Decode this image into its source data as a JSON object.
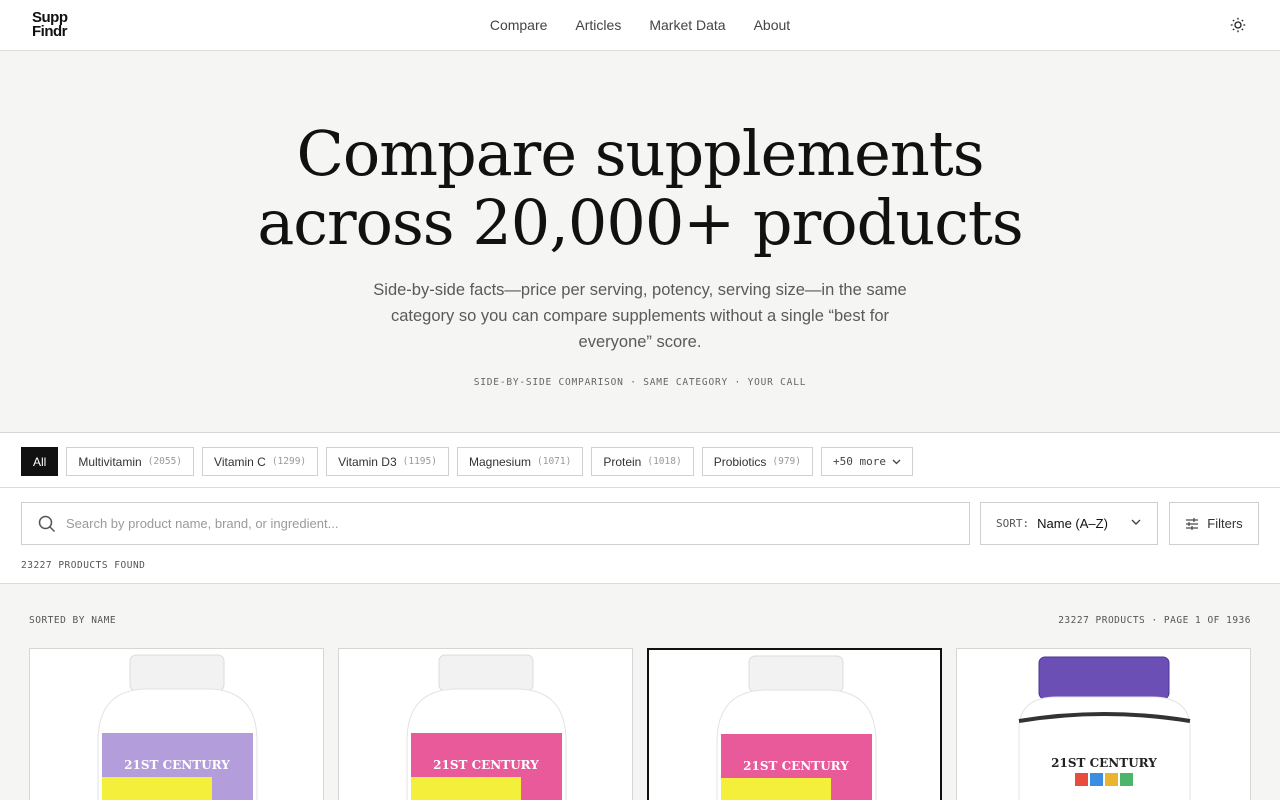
{
  "header": {
    "logo_line1": "Supp",
    "logo_line2": "Findr",
    "nav": [
      "Compare",
      "Articles",
      "Market Data",
      "About"
    ]
  },
  "hero": {
    "title_line1": "Compare supplements",
    "title_line2": "across 20,000+ products",
    "subtitle": "Side-by-side facts—price per serving, potency, serving size—in the same category so you can compare supplements without a single “best for everyone” score.",
    "tagline": "SIDE-BY-SIDE COMPARISON · SAME CATEGORY · YOUR CALL"
  },
  "categories": [
    {
      "label": "All",
      "count": ""
    },
    {
      "label": "Multivitamin",
      "count": "(2055)"
    },
    {
      "label": "Vitamin C",
      "count": "(1299)"
    },
    {
      "label": "Vitamin D3",
      "count": "(1195)"
    },
    {
      "label": "Magnesium",
      "count": "(1071)"
    },
    {
      "label": "Protein",
      "count": "(1018)"
    },
    {
      "label": "Probiotics",
      "count": "(979)"
    }
  ],
  "more_categories": "+50 more",
  "search": {
    "placeholder": "Search by product name, brand, or ingredient...",
    "value": ""
  },
  "sort": {
    "label": "SORT:",
    "value": "Name (A–Z)"
  },
  "filters_label": "Filters",
  "products_found": "23227 PRODUCTS FOUND",
  "results": {
    "sorted_by": "SORTED BY NAME",
    "pagination": "23227 PRODUCTS · PAGE 1 OF 1936"
  },
  "product_cards": [
    {
      "brand_text": "21ST CENTURY",
      "label_color": "#b39ddb",
      "band_color": "#f3ef3a",
      "cap_color": "#f2f2f2",
      "selected": false
    },
    {
      "brand_text": "21ST CENTURY",
      "label_color": "#e85a9a",
      "band_color": "#f3ef3a",
      "cap_color": "#f2f2f2",
      "selected": false
    },
    {
      "brand_text": "21ST CENTURY",
      "label_color": "#e85a9a",
      "band_color": "#f3ef3a",
      "cap_color": "#f2f2f2",
      "selected": true
    },
    {
      "brand_text": "21ST CENTURY",
      "label_color": "#ffffff",
      "band_color": "#ffffff",
      "cap_color": "#6b4fb5",
      "selected": false
    }
  ],
  "colors": {
    "accent": "#111111",
    "hero_bg": "#f5f5f4",
    "border": "#d0d0d0"
  },
  "icons": {
    "theme_toggle": "sun-icon",
    "search": "search-icon",
    "sort_chevron": "chevron-down-icon",
    "filters": "sliders-icon"
  }
}
